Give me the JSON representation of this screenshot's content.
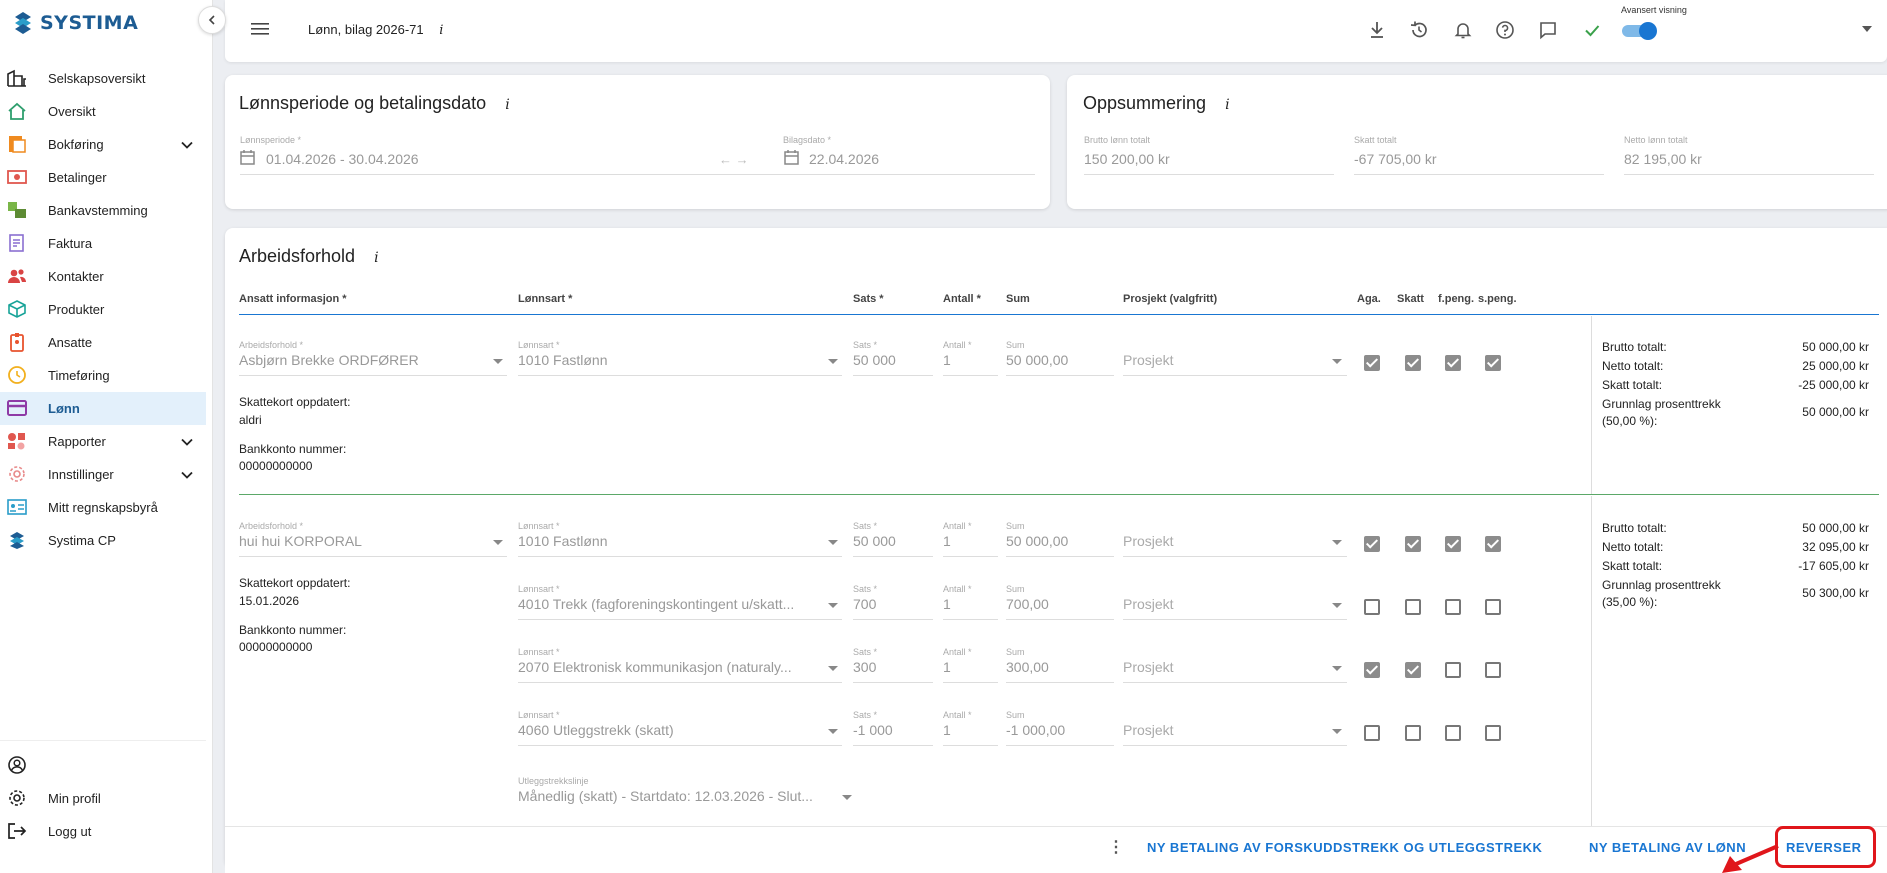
{
  "brand": {
    "name": "SYSTIMA",
    "color": "#1d5c93"
  },
  "sidebar": {
    "items": [
      {
        "label": "Selskapsoversikt",
        "icon": "buildings-icon",
        "color": "#222222"
      },
      {
        "label": "Oversikt",
        "icon": "home-icon",
        "color": "#2e9e6d"
      },
      {
        "label": "Bokføring",
        "icon": "ledger-icon",
        "color": "#ef8a1f",
        "expandable": true
      },
      {
        "label": "Betalinger",
        "icon": "money-icon",
        "color": "#e0574f"
      },
      {
        "label": "Bankavstemming",
        "icon": "bank-reconcile-icon",
        "color": "#7ab648"
      },
      {
        "label": "Faktura",
        "icon": "invoice-icon",
        "color": "#8a6fd1"
      },
      {
        "label": "Kontakter",
        "icon": "contacts-icon",
        "color": "#d94343"
      },
      {
        "label": "Produkter",
        "icon": "cube-icon",
        "color": "#17a398"
      },
      {
        "label": "Ansatte",
        "icon": "badge-icon",
        "color": "#e8532e"
      },
      {
        "label": "Timeføring",
        "icon": "clock-icon",
        "color": "#f2b01e"
      },
      {
        "label": "Lønn",
        "icon": "card-icon",
        "color": "#8e3aa6",
        "active": true
      },
      {
        "label": "Rapporter",
        "icon": "reports-icon",
        "color": "#e0574f",
        "expandable": true
      },
      {
        "label": "Innstillinger",
        "icon": "gear-icon",
        "color": "#e88a8a",
        "expandable": true
      },
      {
        "label": "Mitt regnskapsbyrå",
        "icon": "id-card-icon",
        "color": "#2a9dc9"
      },
      {
        "label": "Systima CP",
        "icon": "systima-icon",
        "color": "#1d5c93"
      }
    ],
    "bottom": [
      {
        "label": "",
        "icon": "account-circle-icon"
      },
      {
        "label": "Min profil",
        "icon": "gear-icon"
      },
      {
        "label": "Logg ut",
        "icon": "logout-icon"
      }
    ]
  },
  "topbar": {
    "title": "Lønn, bilag 2026-71",
    "info": "i",
    "toggle_label": "Avansert visning",
    "toggle_on": true,
    "accent": "#1976d2"
  },
  "period_card": {
    "title": "Lønnsperiode og betalingsdato",
    "info": "i",
    "period_label": "Lønnsperiode *",
    "period_value": "01.04.2026 - 30.04.2026",
    "arrows": "← →",
    "date_label": "Bilagsdato *",
    "date_value": "22.04.2026"
  },
  "summary_card": {
    "title": "Oppsummering",
    "info": "i",
    "fields": [
      {
        "label": "Brutto lønn totalt",
        "value": "150 200,00 kr"
      },
      {
        "label": "Skatt totalt",
        "value": "-67 705,00 kr"
      },
      {
        "label": "Netto lønn totalt",
        "value": "82 195,00 kr"
      }
    ]
  },
  "employment": {
    "title": "Arbeidsforhold",
    "info": "i",
    "headers": {
      "employee": "Ansatt informasjon *",
      "type": "Lønnsart *",
      "rate": "Sats *",
      "qty": "Antall *",
      "sum": "Sum",
      "project": "Prosjekt (valgfritt)",
      "aga": "Aga.",
      "tax": "Skatt",
      "fpeng": "f.peng.",
      "speng": "s.peng."
    },
    "field_labels": {
      "employment": "Arbeidsforhold *",
      "type": "Lønnsart *",
      "rate": "Sats *",
      "qty": "Antall *",
      "sum": "Sum",
      "project_placeholder": "Prosjekt",
      "tax_card": "Skattekort oppdatert:",
      "bank": "Bankkonto nummer:",
      "deduction_line": "Utleggstrekkslinje"
    },
    "employees": [
      {
        "name": "Asbjørn Brekke ORDFØRER",
        "tax_card_date": "aldri",
        "bank_account": "00000000000",
        "lines": [
          {
            "type": "1010 Fastlønn",
            "rate": "50 000",
            "qty": "1",
            "sum": "50 000,00",
            "checks": [
              true,
              true,
              true,
              true
            ]
          }
        ],
        "totals": {
          "brutto_label": "Brutto totalt:",
          "brutto": "50 000,00 kr",
          "netto_label": "Netto totalt:",
          "netto": "25 000,00 kr",
          "skatt_label": "Skatt totalt:",
          "skatt": "-25 000,00 kr",
          "grunnlag_label": "Grunnlag prosenttrekk (50,00 %):",
          "grunnlag": "50 000,00 kr"
        }
      },
      {
        "name": "hui hui KORPORAL",
        "tax_card_date": "15.01.2026",
        "bank_account": "00000000000",
        "lines": [
          {
            "type": "1010 Fastlønn",
            "rate": "50 000",
            "qty": "1",
            "sum": "50 000,00",
            "checks": [
              true,
              true,
              true,
              true
            ]
          },
          {
            "type": "4010 Trekk (fagforeningskontingent u/skatt...",
            "rate": "700",
            "qty": "1",
            "sum": "700,00",
            "checks": [
              false,
              false,
              false,
              false
            ]
          },
          {
            "type": "2070 Elektronisk kommunikasjon (naturaly...",
            "rate": "300",
            "qty": "1",
            "sum": "300,00",
            "checks": [
              true,
              true,
              false,
              false
            ]
          },
          {
            "type": "4060 Utleggstrekk (skatt)",
            "rate": "-1 000",
            "qty": "1",
            "sum": "-1 000,00",
            "checks": [
              false,
              false,
              false,
              false
            ]
          }
        ],
        "deduction_value": "Månedlig (skatt) - Startdato: 12.03.2026 - Slut...",
        "totals": {
          "brutto_label": "Brutto totalt:",
          "brutto": "50 000,00 kr",
          "netto_label": "Netto totalt:",
          "netto": "32 095,00 kr",
          "skatt_label": "Skatt totalt:",
          "skatt": "-17 605,00 kr",
          "grunnlag_label": "Grunnlag prosenttrekk (35,00 %):",
          "grunnlag": "50 300,00 kr"
        }
      }
    ]
  },
  "bottom_bar": {
    "more": "⋮",
    "btn_forskudd": "NY BETALING AV FORSKUDDSTREKK OG UTLEGGSTREKK",
    "btn_lonn": "NY BETALING AV LØNN",
    "btn_reverser": "REVERSER",
    "highlight_color": "#e0161b"
  }
}
